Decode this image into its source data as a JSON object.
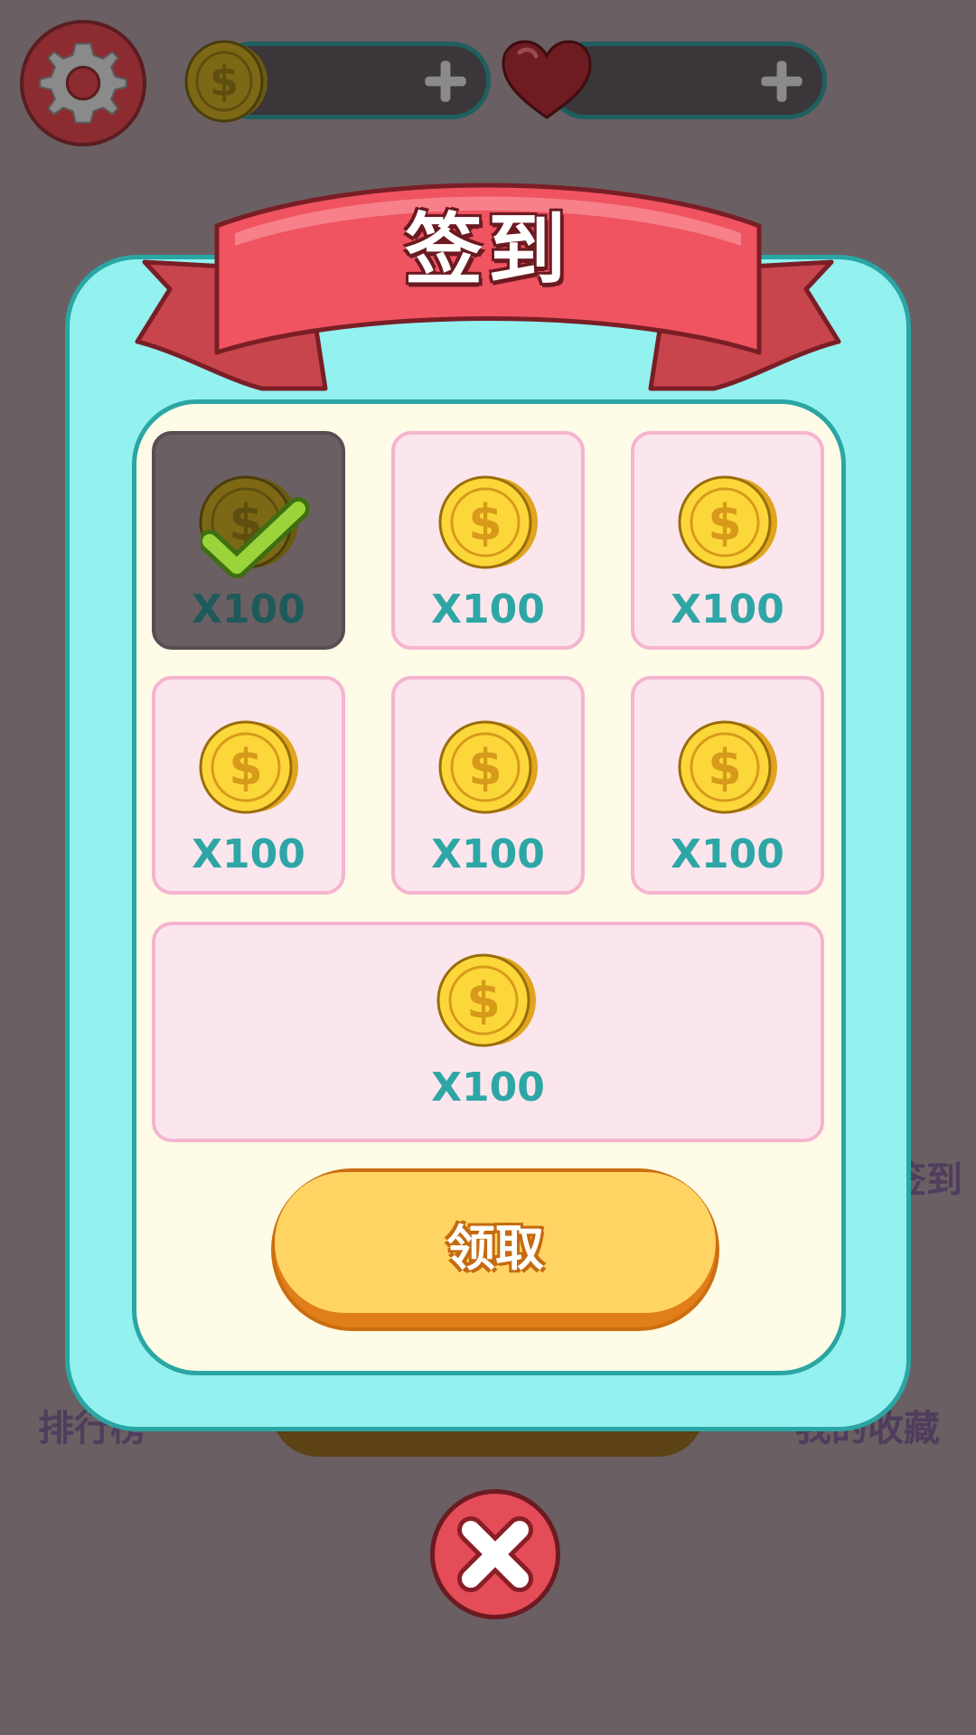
{
  "hud": {
    "settings_icon": "gear-icon",
    "coin_icon": "coin-icon",
    "heart_icon": "heart-icon",
    "add_icon": "plus-icon"
  },
  "background_menu": {
    "left_label": "排行榜",
    "right_label": "我的收藏",
    "right_top_label": "签到"
  },
  "dialog": {
    "title": "签到",
    "rewards": [
      {
        "amount": "X100",
        "claimed": true
      },
      {
        "amount": "X100",
        "claimed": false
      },
      {
        "amount": "X100",
        "claimed": false
      },
      {
        "amount": "X100",
        "claimed": false
      },
      {
        "amount": "X100",
        "claimed": false
      },
      {
        "amount": "X100",
        "claimed": false
      },
      {
        "amount": "X100",
        "claimed": false
      }
    ],
    "claim_button": "领取",
    "close_icon": "close-icon"
  },
  "colors": {
    "overlay": "#6a5f63",
    "dialog_bg": "#93f1f0",
    "ribbon": "#ef5460",
    "cell_bg": "#fce6ee",
    "button": "#ffd463"
  }
}
